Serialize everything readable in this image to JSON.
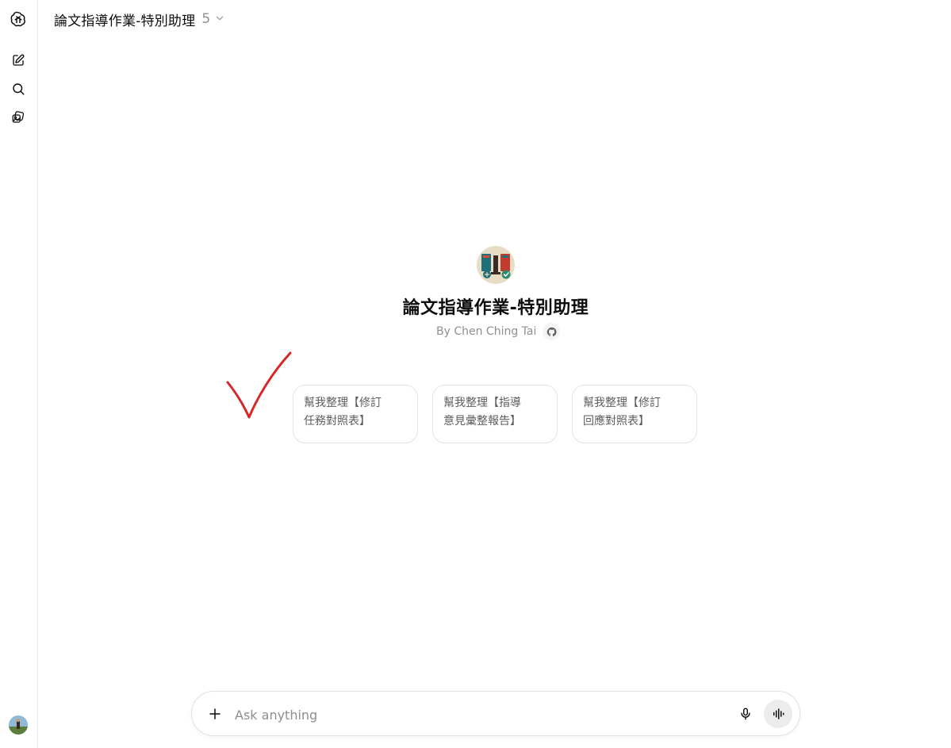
{
  "header": {
    "title": "論文指導作業-特別助理",
    "version": "5"
  },
  "rail": {
    "items": [
      {
        "icon": "openai-logo-icon"
      },
      {
        "icon": "new-chat-icon"
      },
      {
        "icon": "search-icon"
      },
      {
        "icon": "library-icon"
      }
    ],
    "account_icon": "user-avatar"
  },
  "gpt": {
    "name": "論文指導作業-特別助理",
    "byline": "By Chen Ching Tai",
    "link_icon": "github-icon"
  },
  "suggestions": [
    {
      "line1": "幫我整理【修訂",
      "line2": "任務對照表】"
    },
    {
      "line1": "幫我整理【指導",
      "line2": "意見彙整報告】"
    },
    {
      "line1": "幫我整理【修訂",
      "line2": "回應對照表】"
    }
  ],
  "composer": {
    "placeholder": "Ask anything",
    "value": ""
  },
  "colors": {
    "annotation": "#d62828",
    "muted_text": "#8f8f8f"
  }
}
